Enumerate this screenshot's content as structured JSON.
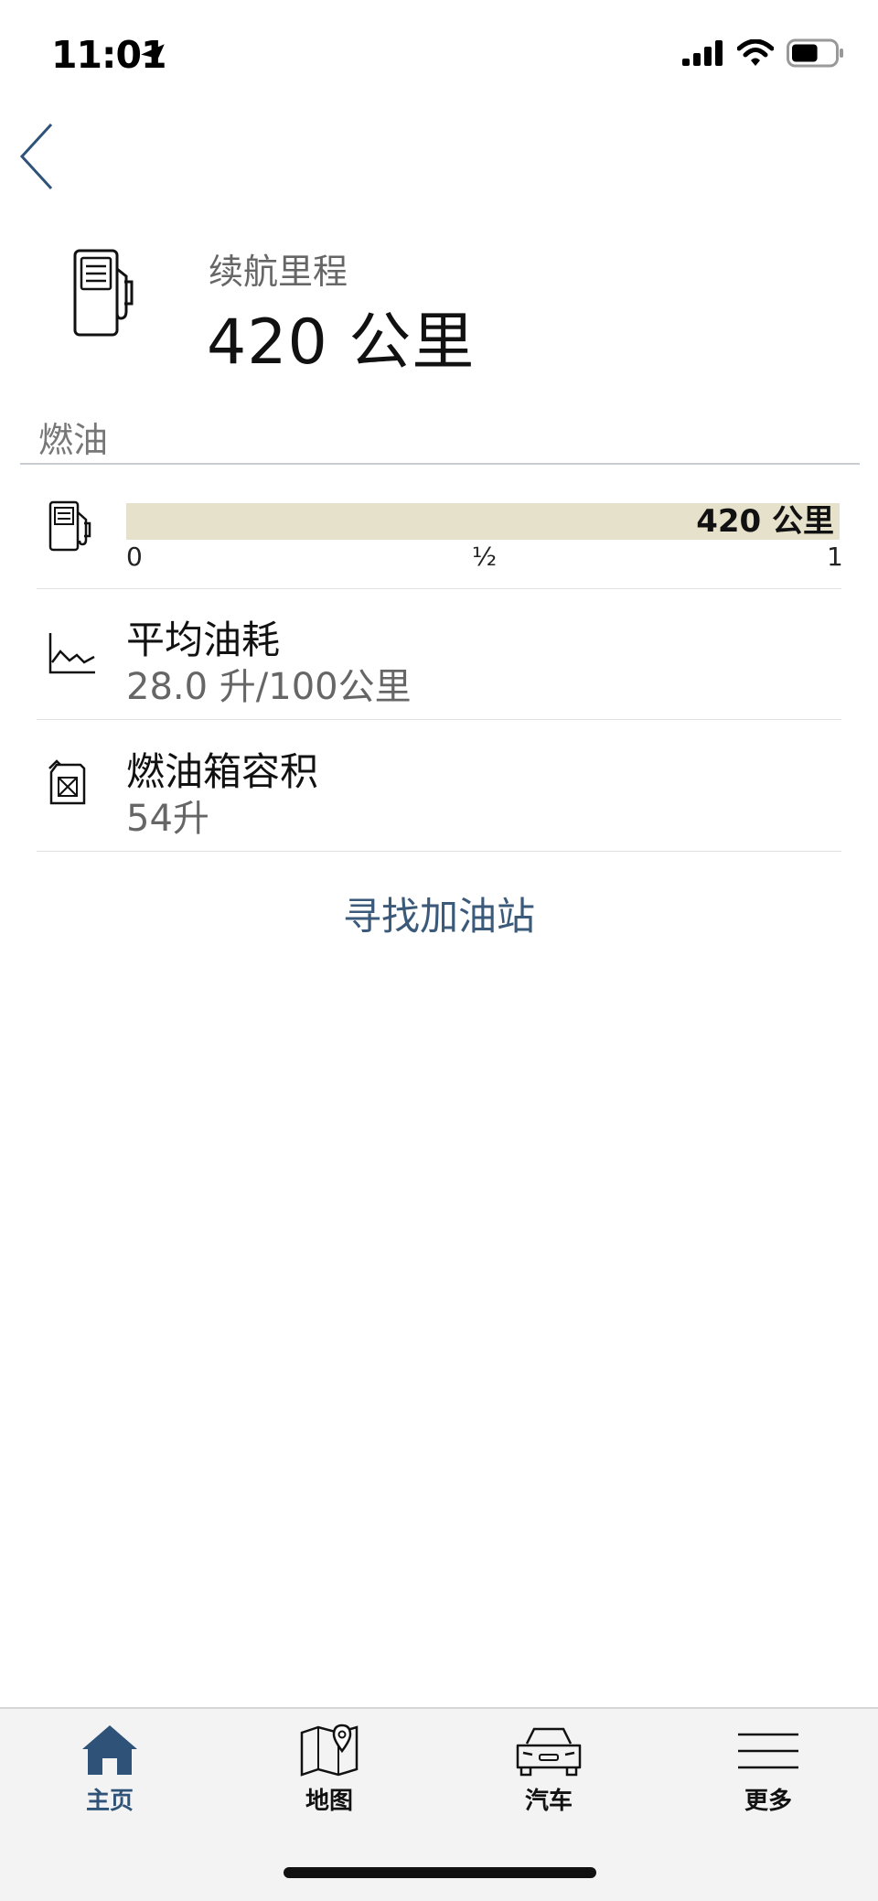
{
  "status": {
    "time": "11:01",
    "battery_percent": 60
  },
  "header": {
    "range_label": "续航里程",
    "range_value": "420 公里"
  },
  "fuel_section": {
    "title": "燃油",
    "fuel_level": 1.0,
    "bar_label": "420 公里",
    "ticks": [
      "0",
      "½",
      "1"
    ]
  },
  "rows": [
    {
      "title": "平均油耗",
      "value": "28.0 升/100公里",
      "icon": "chart-icon"
    },
    {
      "title": "燃油箱容积",
      "value": "54升",
      "icon": "jerrycan-icon"
    }
  ],
  "find_station_label": "寻找加油站",
  "tabs": [
    {
      "label": "主页",
      "icon": "home-icon",
      "active": true
    },
    {
      "label": "地图",
      "icon": "map-icon",
      "active": false
    },
    {
      "label": "汽车",
      "icon": "car-icon",
      "active": false
    },
    {
      "label": "更多",
      "icon": "menu-icon",
      "active": false
    }
  ],
  "colors": {
    "accent": "#2f5378",
    "link": "#3b5a7a",
    "fuel_bar": "#e6e1cb"
  }
}
